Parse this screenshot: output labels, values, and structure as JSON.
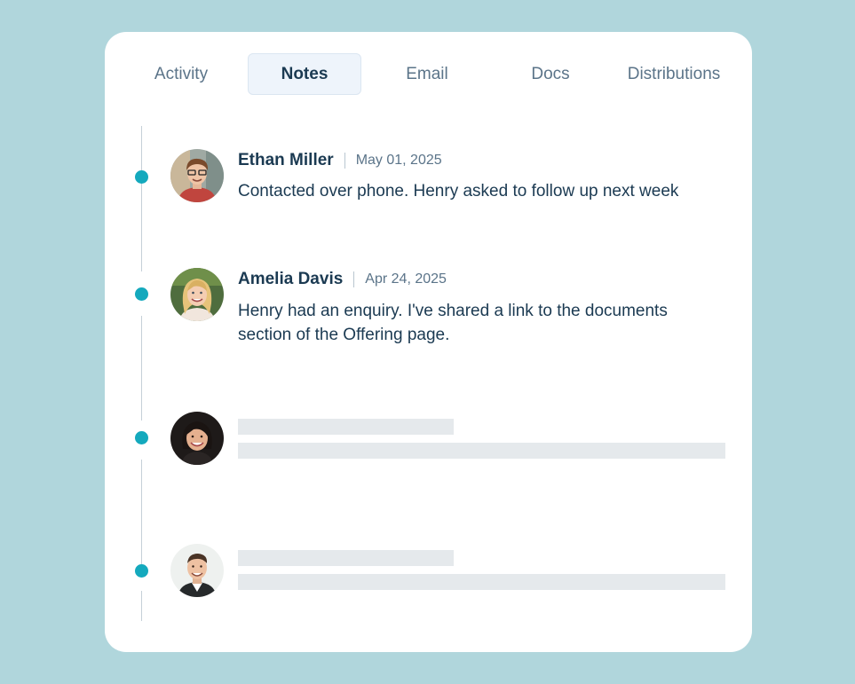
{
  "tabs": [
    {
      "label": "Activity",
      "active": false
    },
    {
      "label": "Notes",
      "active": true
    },
    {
      "label": "Email",
      "active": false
    },
    {
      "label": "Docs",
      "active": false
    },
    {
      "label": "Distributions",
      "active": false
    }
  ],
  "notes": [
    {
      "author": "Ethan Miller",
      "date": "May 01, 2025",
      "text": "Contacted over phone. Henry asked to follow up next week",
      "avatar": "avatar-ethan-miller"
    },
    {
      "author": "Amelia Davis",
      "date": "Apr 24, 2025",
      "text": "Henry had an enquiry. I've shared a link to the documents section of the Offering page.",
      "avatar": "avatar-amelia-davis"
    },
    {
      "author": "",
      "date": "",
      "text": "",
      "avatar": "avatar-placeholder-3",
      "loading": true
    },
    {
      "author": "",
      "date": "",
      "text": "",
      "avatar": "avatar-placeholder-4",
      "loading": true
    }
  ],
  "colors": {
    "background": "#b0d6dc",
    "card": "#ffffff",
    "accent_dot": "#14a9bd",
    "text_primary": "#1b3a52",
    "text_secondary": "#5b7489",
    "skeleton": "#e5e9ec",
    "active_tab_bg": "#eef4fb"
  }
}
